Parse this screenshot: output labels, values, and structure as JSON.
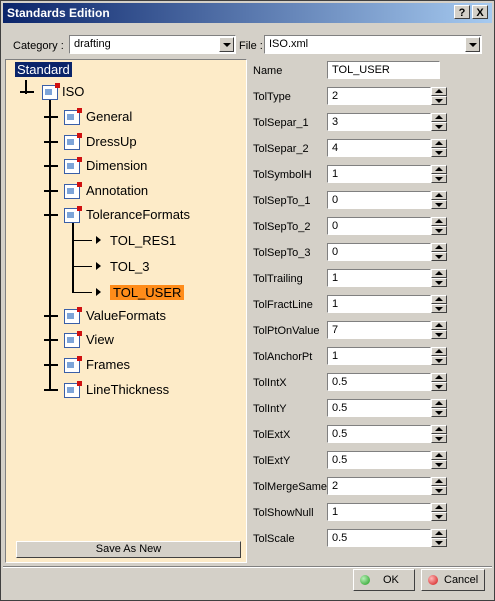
{
  "window": {
    "title": "Standards Edition",
    "help_label": "?",
    "close_label": "X"
  },
  "category": {
    "label": "Category :",
    "value": "drafting"
  },
  "file": {
    "label": "File :",
    "value": "ISO.xml"
  },
  "tree": {
    "root": "Standard",
    "iso": "ISO",
    "items": [
      "General",
      "DressUp",
      "Dimension",
      "Annotation",
      "ToleranceFormats",
      "ValueFormats",
      "View",
      "Frames",
      "LineThickness"
    ],
    "tolerance_children": [
      "TOL_RES1",
      "TOL_3",
      "TOL_USER"
    ]
  },
  "save_as_new_label": "Save As New",
  "properties": [
    {
      "name": "Name",
      "value": "TOL_USER"
    },
    {
      "name": "TolType",
      "value": "2"
    },
    {
      "name": "TolSepar_1",
      "value": "3"
    },
    {
      "name": "TolSepar_2",
      "value": "4"
    },
    {
      "name": "TolSymbolH",
      "value": "1"
    },
    {
      "name": "TolSepTo_1",
      "value": "0"
    },
    {
      "name": "TolSepTo_2",
      "value": "0"
    },
    {
      "name": "TolSepTo_3",
      "value": "0"
    },
    {
      "name": "TolTrailing",
      "value": "1"
    },
    {
      "name": "TolFractLine",
      "value": "1"
    },
    {
      "name": "TolPtOnValue",
      "value": "7"
    },
    {
      "name": "TolAnchorPt",
      "value": "1"
    },
    {
      "name": "TolIntX",
      "value": "0.5"
    },
    {
      "name": "TolIntY",
      "value": "0.5"
    },
    {
      "name": "TolExtX",
      "value": "0.5"
    },
    {
      "name": "TolExtY",
      "value": "0.5"
    },
    {
      "name": "TolMergeSame",
      "value": "2"
    },
    {
      "name": "TolShowNull",
      "value": "1"
    },
    {
      "name": "TolScale",
      "value": "0.5"
    }
  ],
  "buttons": {
    "ok": "OK",
    "cancel": "Cancel"
  },
  "colors": {
    "selected_highlight": "#ff8c1a",
    "root_highlight": "#0a246a",
    "tree_background": "#fdebc8",
    "ok_dot": "#1a9a1a",
    "cancel_dot": "#d01010"
  }
}
